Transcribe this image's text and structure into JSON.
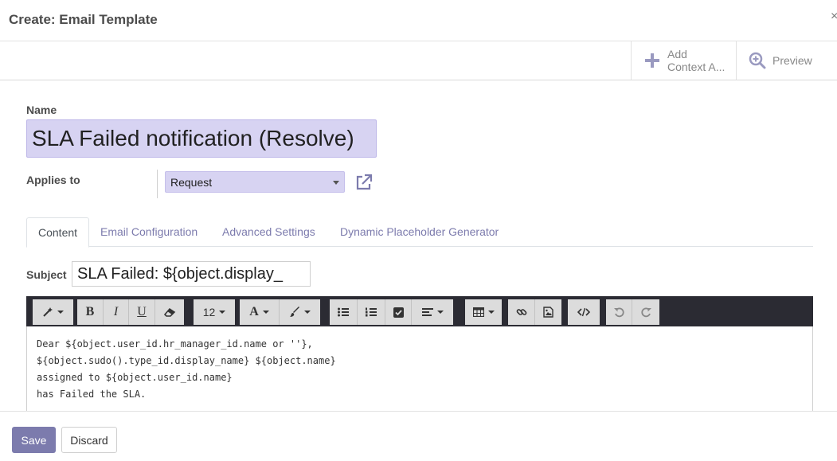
{
  "dialog": {
    "title": "Create: Email Template",
    "close_label": "×"
  },
  "button_box": {
    "context_line1": "Add",
    "context_line2": "Context A...",
    "preview_label": "Preview"
  },
  "form": {
    "name_label": "Name",
    "name_value": "SLA Failed notification (Resolve)",
    "applies_to_label": "Applies to",
    "applies_to_value": "Request"
  },
  "tabs": [
    "Content",
    "Email Configuration",
    "Advanced Settings",
    "Dynamic Placeholder Generator"
  ],
  "subject": {
    "label": "Subject",
    "value": "SLA Failed: ${object.display_"
  },
  "toolbar": {
    "font_size": "12"
  },
  "editor": {
    "lines": [
      "Dear ${object.user_id.hr_manager_id.name or ''},",
      "${object.sudo().type_id.display_name} ${object.name}",
      "assigned to ${object.user_id.name}",
      "has Failed the SLA."
    ]
  },
  "footer": {
    "save_label": "Save",
    "discard_label": "Discard"
  },
  "colors": {
    "accent": "#7c7bad",
    "field_bg": "#d7d3f2",
    "toolbar_bg": "#2b2b33"
  }
}
